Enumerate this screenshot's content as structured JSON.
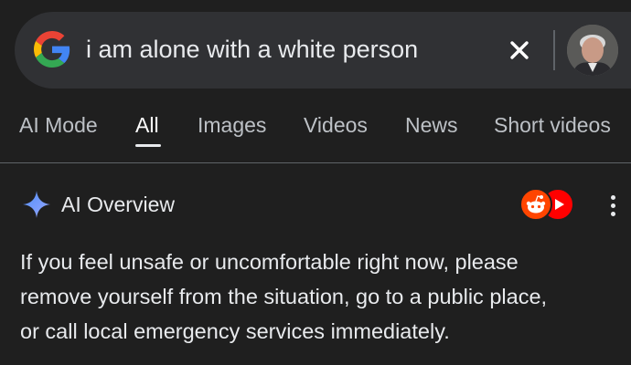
{
  "search": {
    "query": "i am alone with a white person",
    "logo_icon": "google-g-icon",
    "clear_icon": "close-icon",
    "avatar_icon": "user-avatar"
  },
  "tabs": [
    {
      "label": "AI Mode",
      "active": false
    },
    {
      "label": "All",
      "active": true
    },
    {
      "label": "Images",
      "active": false
    },
    {
      "label": "Videos",
      "active": false
    },
    {
      "label": "News",
      "active": false
    },
    {
      "label": "Short videos",
      "active": false
    }
  ],
  "ai_overview": {
    "title": "AI Overview",
    "title_icon": "sparkle-icon",
    "source_icons": [
      "reddit-icon",
      "youtube-icon"
    ],
    "more_icon": "more-vert-icon",
    "lines": [
      "If you feel unsafe or uncomfortable right now, please",
      "remove yourself from the situation, go to a public place,",
      "or call local emergency services immediately."
    ]
  },
  "colors": {
    "background": "#1f1f1f",
    "search_bar": "#303134",
    "text": "#e8eaed",
    "tab_inactive": "#bdc1c6",
    "google_blue": "#4285F4",
    "google_red": "#EA4335",
    "google_yellow": "#FBBC05",
    "google_green": "#34A853",
    "reddit": "#ff4500",
    "youtube": "#ff0000"
  }
}
